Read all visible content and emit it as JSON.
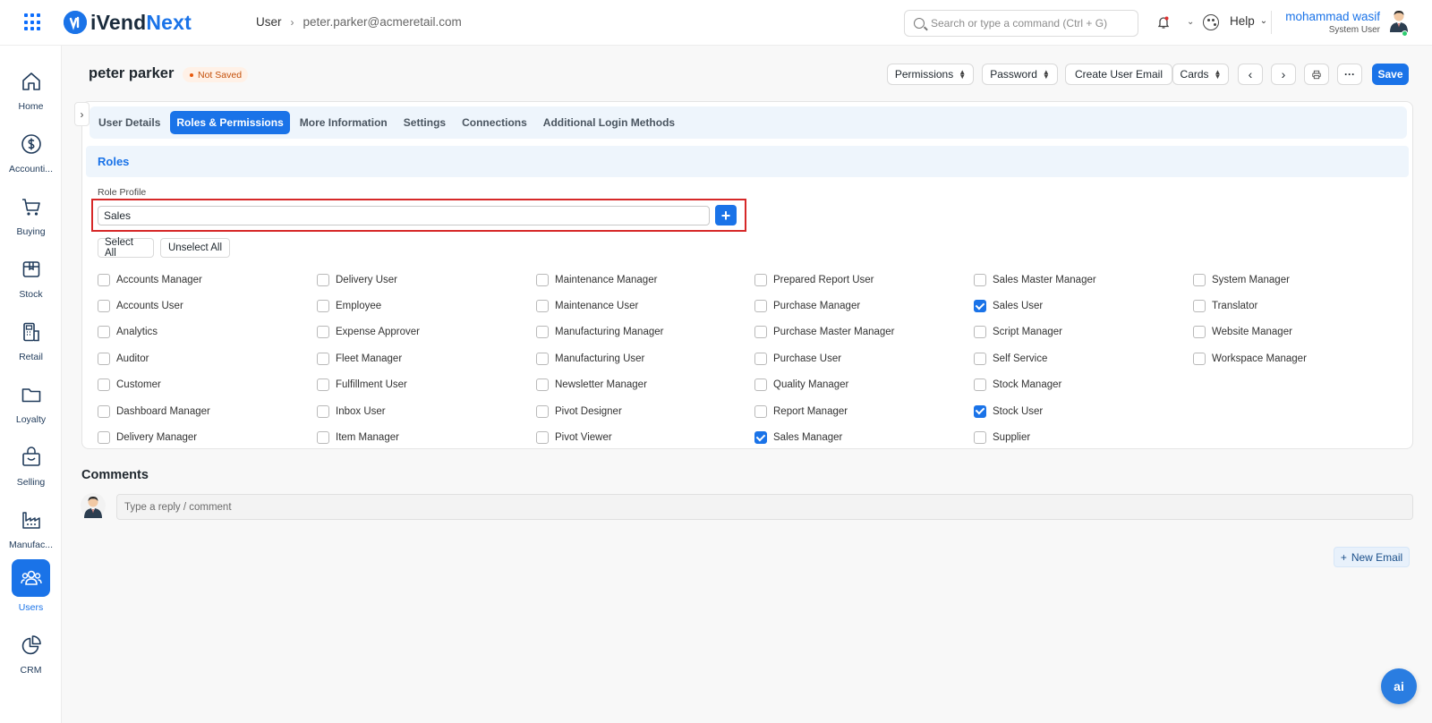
{
  "topbar": {
    "app_name_part1": "iVend",
    "app_name_part2": "Next",
    "breadcrumb": [
      "User",
      "peter.parker@acmeretail.com"
    ],
    "search_placeholder": "Search or type a command (Ctrl + G)",
    "help_label": "Help",
    "user_name": "mohammad wasif",
    "user_role": "System User"
  },
  "sidebar": {
    "items": [
      {
        "label": "Home",
        "icon": "home-icon"
      },
      {
        "label": "Accounti...",
        "icon": "dollar-icon"
      },
      {
        "label": "Buying",
        "icon": "cart-icon"
      },
      {
        "label": "Stock",
        "icon": "box-icon"
      },
      {
        "label": "Retail",
        "icon": "pos-icon"
      },
      {
        "label": "Loyalty",
        "icon": "folder-icon"
      },
      {
        "label": "Selling",
        "icon": "shopping-bag-icon"
      },
      {
        "label": "Manufac...",
        "icon": "factory-icon"
      },
      {
        "label": "Users",
        "icon": "users-icon",
        "active": true
      },
      {
        "label": "CRM",
        "icon": "pie-chart-icon"
      }
    ]
  },
  "page": {
    "title": "peter parker",
    "status": "Not Saved",
    "actions": {
      "permissions": "Permissions",
      "password": "Password",
      "create_user_email": "Create User Email",
      "cards": "Cards",
      "save": "Save"
    }
  },
  "tabs": [
    "User Details",
    "Roles & Permissions",
    "More Information",
    "Settings",
    "Connections",
    "Additional Login Methods"
  ],
  "active_tab": "Roles & Permissions",
  "roles_section": {
    "title": "Roles",
    "role_profile_label": "Role Profile",
    "role_profile_value": "Sales",
    "select_all": "Select All",
    "unselect_all": "Unselect All",
    "columns": [
      [
        {
          "label": "Accounts Manager",
          "checked": false
        },
        {
          "label": "Accounts User",
          "checked": false
        },
        {
          "label": "Analytics",
          "checked": false
        },
        {
          "label": "Auditor",
          "checked": false
        },
        {
          "label": "Customer",
          "checked": false
        },
        {
          "label": "Dashboard Manager",
          "checked": false
        },
        {
          "label": "Delivery Manager",
          "checked": false
        }
      ],
      [
        {
          "label": "Delivery User",
          "checked": false
        },
        {
          "label": "Employee",
          "checked": false
        },
        {
          "label": "Expense Approver",
          "checked": false
        },
        {
          "label": "Fleet Manager",
          "checked": false
        },
        {
          "label": "Fulfillment User",
          "checked": false
        },
        {
          "label": "Inbox User",
          "checked": false
        },
        {
          "label": "Item Manager",
          "checked": false
        }
      ],
      [
        {
          "label": "Maintenance Manager",
          "checked": false
        },
        {
          "label": "Maintenance User",
          "checked": false
        },
        {
          "label": "Manufacturing Manager",
          "checked": false
        },
        {
          "label": "Manufacturing User",
          "checked": false
        },
        {
          "label": "Newsletter Manager",
          "checked": false
        },
        {
          "label": "Pivot Designer",
          "checked": false
        },
        {
          "label": "Pivot Viewer",
          "checked": false
        }
      ],
      [
        {
          "label": "Prepared Report User",
          "checked": false
        },
        {
          "label": "Purchase Manager",
          "checked": false
        },
        {
          "label": "Purchase Master Manager",
          "checked": false
        },
        {
          "label": "Purchase User",
          "checked": false
        },
        {
          "label": "Quality Manager",
          "checked": false
        },
        {
          "label": "Report Manager",
          "checked": false
        },
        {
          "label": "Sales Manager",
          "checked": true
        }
      ],
      [
        {
          "label": "Sales Master Manager",
          "checked": false
        },
        {
          "label": "Sales User",
          "checked": true
        },
        {
          "label": "Script Manager",
          "checked": false
        },
        {
          "label": "Self Service",
          "checked": false
        },
        {
          "label": "Stock Manager",
          "checked": false
        },
        {
          "label": "Stock User",
          "checked": true
        },
        {
          "label": "Supplier",
          "checked": false
        }
      ],
      [
        {
          "label": "System Manager",
          "checked": false
        },
        {
          "label": "Translator",
          "checked": false
        },
        {
          "label": "Website Manager",
          "checked": false
        },
        {
          "label": "Workspace Manager",
          "checked": false
        }
      ]
    ]
  },
  "comments": {
    "title": "Comments",
    "placeholder": "Type a reply / comment",
    "new_email": "New Email"
  },
  "ai_label": "ai",
  "colors": {
    "accent": "#1a73e8",
    "highlight": "#d62828",
    "status": "#c4500a"
  }
}
